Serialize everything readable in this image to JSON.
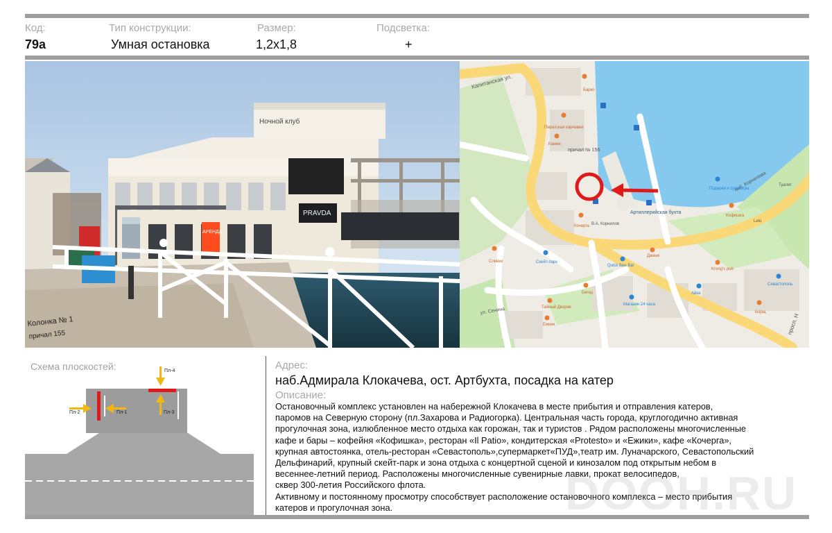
{
  "header": {
    "code_label": "Код:",
    "code_value": "79а",
    "type_label": "Тип конструкции:",
    "type_value": "Умная остановка",
    "size_label": "Размер:",
    "size_value": "1,2х1,8",
    "light_label": "Подсветка:",
    "light_value": "+"
  },
  "photo": {
    "club_sign": "Ночной клуб",
    "pravda_sign": "PRAVDA",
    "arenda_sign": "АРЕНДА",
    "handwritten_line1": "Колонка № 1",
    "handwritten_line2": "причал 155"
  },
  "map": {
    "street_kapitanskaya": "Капитанская ул.",
    "street_kornilova": "наб. Корнилова",
    "street_senin": "ул. Сенина",
    "street_prosp": "просп. Н",
    "bay_name": "Артиллерийская бухта",
    "pier": "причал № 156",
    "poi_kachergа": "Кочерга",
    "poi_kofishka": "Кофишка",
    "poi_skatepark": "Скейт-парк",
    "poi_quickbee": "Quick Bee Bar",
    "poi_dzhani": "Джани",
    "poi_kings": "Krong's pub",
    "poi_sevastopol": "Севастополь",
    "poi_aika": "Айка",
    "poi_borshch": "Борщ",
    "poi_ezhiki": "Ежики",
    "poi_verged": "Бегед",
    "poi_magazin": "Магазин 24 часа",
    "poi_podsuvenir": "Подарки и сувениры",
    "poi_kamni": "Камни",
    "poi_pirat": "Пиратская харчевня",
    "poi_barko": "Барко",
    "poi_zhuk": "В.А. Корнилов",
    "poi_tainstvo": "Тайный Дворик",
    "poi_slivki": "Сливки",
    "poi_toilet": "Туалет",
    "poi_lelo": "Lelo"
  },
  "scheme": {
    "title": "Схема плоскостей:",
    "planes": [
      "Пл-1",
      "Пл-2",
      "Пл-3",
      "Пл-4"
    ]
  },
  "address": {
    "label": "Адрес:",
    "value": "наб.Адмирала Клокачева, ост. Артбухта, посадка на катер"
  },
  "description": {
    "label": "Описание:",
    "lines": [
      "Остановочный  комплекс установлен  на набережной Клокачева в месте прибытия и отправления катеров,",
      "паромов на Северную сторону (пл.Захарова и Радиогорка). Центральная часть города,  круглогодично активная",
      "прогулочная зона, излюбленное место отдыха как горожан, так и туристов . Рядом расположены многочисленные",
      "кафе и бары – кофейня «Кофишка», ресторан «Il Patio», кондитерская «Protesto» и «Ежики», кафе «Кочерга»,",
      "крупная автостоянка, отель-ресторан «Севастополь»,супермаркет«ПУД»,театр им. Луначарского, Севастопольский",
      "Дельфинарий, крупный скейт-парк и зона отдыха с концертной сценой и  кинозалом под открытым небом в",
      "весеннее-летний период. Расположены многочисленные сувенирные лавки, прокат велосипедов,",
      "сквер 300-летия Российского флота.",
      "Активному и постоянному просмотру способствует расположение остановочного комплекса – место прибытия",
      "катеров и прогулочная зона."
    ]
  },
  "watermark": "DOOH.RU",
  "colors": {
    "frame_bar": "#9e9e9e",
    "label_gray": "#a8a8a8",
    "plane_red": "#e0191b",
    "arrow_yellow": "#f2b713",
    "map_water": "#86c9ee",
    "map_green": "#c8e6b0",
    "map_road": "#fbd877"
  }
}
